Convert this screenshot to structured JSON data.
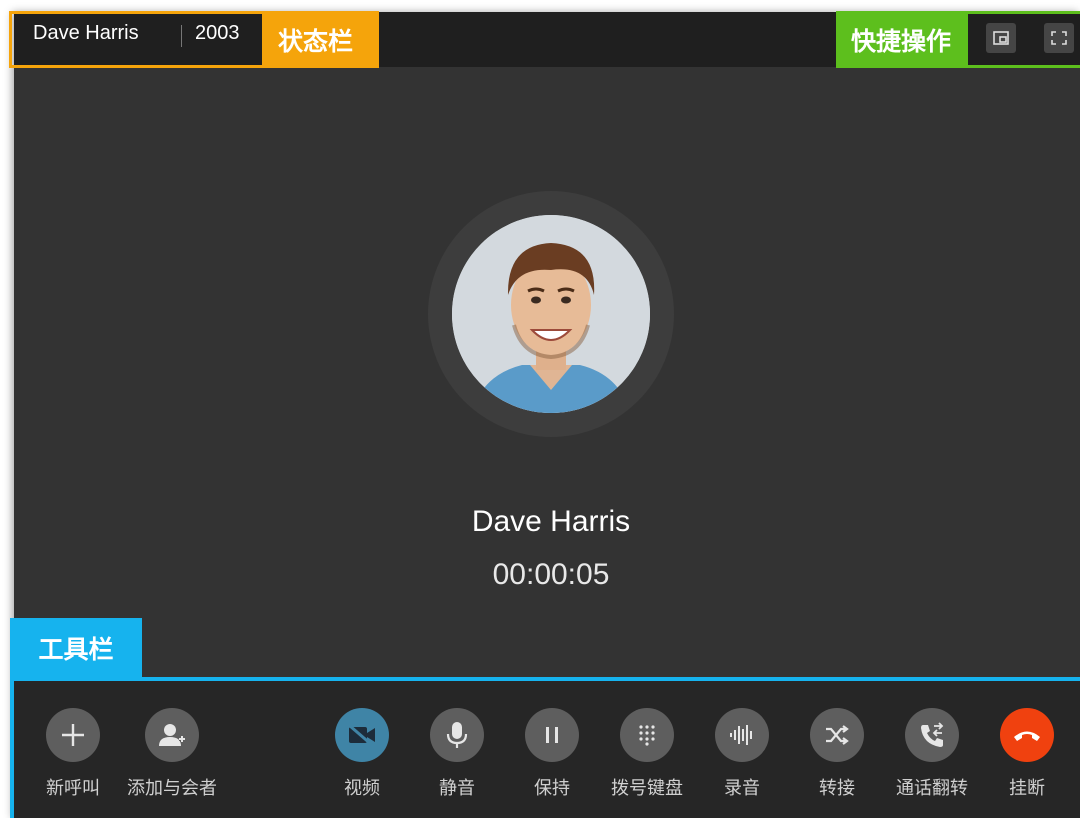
{
  "status_bar": {
    "caller_name": "Dave Harris",
    "extension": "2003",
    "annotation": "状态栏"
  },
  "quick_actions": {
    "annotation": "快捷操作",
    "buttons": [
      {
        "icon": "picture-in-picture-icon"
      },
      {
        "icon": "fullscreen-icon"
      }
    ]
  },
  "call": {
    "name": "Dave Harris",
    "timer": "00:00:05"
  },
  "toolbar": {
    "annotation": "工具栏",
    "buttons": [
      {
        "label": "新呼叫",
        "icon": "plus-icon"
      },
      {
        "label": "添加与会者",
        "icon": "add-participant-icon"
      },
      {
        "label": "视频",
        "icon": "video-off-icon"
      },
      {
        "label": "静音",
        "icon": "microphone-icon"
      },
      {
        "label": "保持",
        "icon": "pause-icon"
      },
      {
        "label": "拨号键盘",
        "icon": "dialpad-icon"
      },
      {
        "label": "录音",
        "icon": "sound-wave-icon"
      },
      {
        "label": "转接",
        "icon": "shuffle-icon"
      },
      {
        "label": "通话翻转",
        "icon": "call-flip-icon"
      },
      {
        "label": "挂断",
        "icon": "hang-up-icon"
      }
    ]
  },
  "colors": {
    "status_annotation": "#f5a40b",
    "quick_annotation": "#5dbf1d",
    "toolbar_annotation": "#16b3ee",
    "hangup": "#f0410f",
    "video_active": "#3f84a6"
  }
}
